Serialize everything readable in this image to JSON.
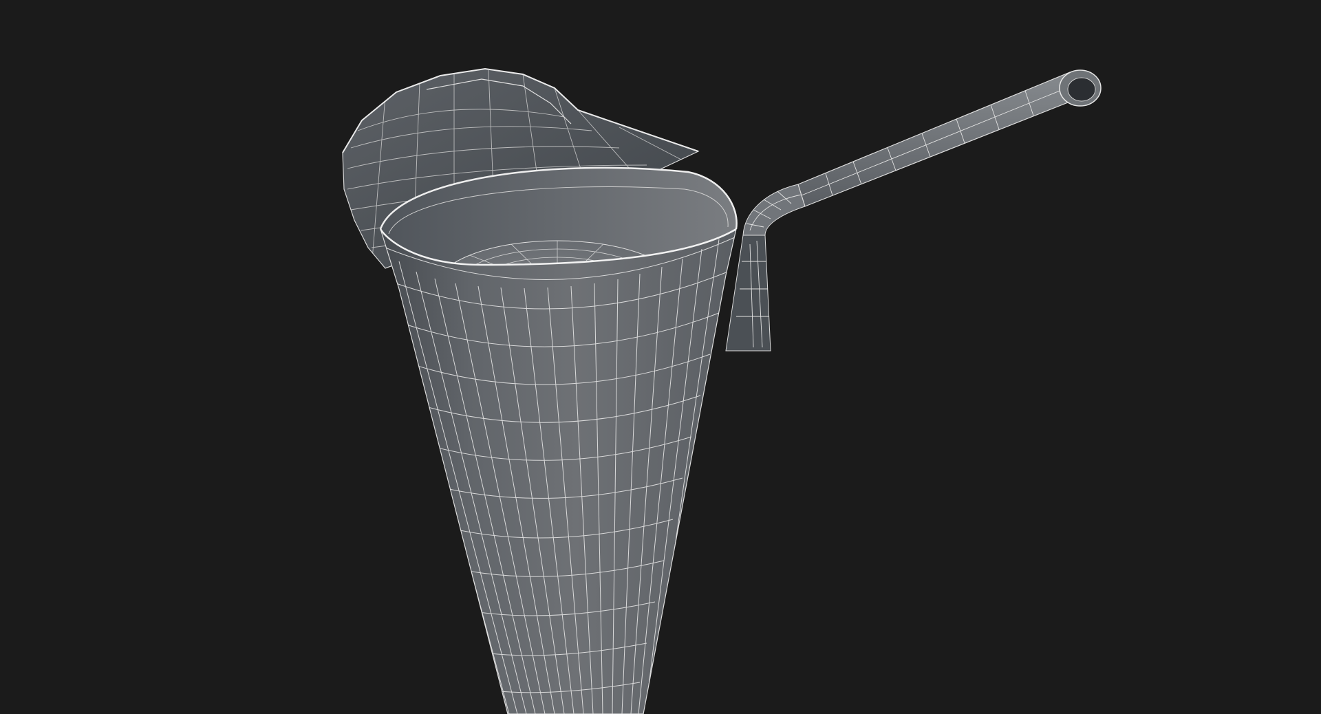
{
  "scene": {
    "subject": "glass-with-straw-and-lemon-slice",
    "render_style": "wireframe",
    "colors": {
      "background": "#1b1b1b",
      "surface": "#6a6d71",
      "surface_dark": "#454a50",
      "surface_light": "#8a8d91",
      "wire": "#e6e6e6"
    }
  }
}
